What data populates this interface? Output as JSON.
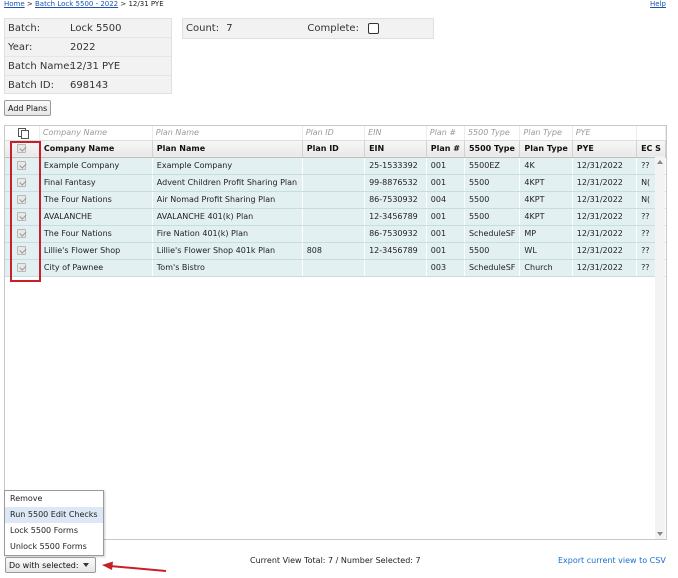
{
  "breadcrumb": {
    "home": "Home",
    "sep1": " > ",
    "batch": "Batch Lock 5500 - 2022",
    "sep2": " > ",
    "current": "12/31 PYE"
  },
  "help": "Help",
  "batch_info": [
    {
      "label": "Batch:",
      "value": "Lock 5500"
    },
    {
      "label": "Year:",
      "value": "2022"
    },
    {
      "label": "Batch Name:",
      "value": "12/31 PYE"
    },
    {
      "label": "Batch ID:",
      "value": "698143"
    }
  ],
  "count": {
    "label": "Count:",
    "value": "7",
    "complete_label": "Complete:",
    "complete_checked": false
  },
  "add_plans_label": "Add Plans",
  "grid": {
    "filter_placeholders": [
      "Company Name",
      "Plan Name",
      "Plan ID",
      "EIN",
      "Plan #",
      "5500 Type",
      "Plan Type",
      "PYE"
    ],
    "columns": [
      "Company Name",
      "Plan Name",
      "Plan ID",
      "EIN",
      "Plan #",
      "5500 Type",
      "Plan Type",
      "PYE",
      "EC S"
    ],
    "rows": [
      {
        "checked": true,
        "company": "Example Company",
        "plan_name": "Example Company",
        "plan_id": "",
        "ein": "25-1533392",
        "plan_num": "001",
        "type_5500": "5500EZ",
        "plan_type": "4K",
        "pye": "12/31/2022",
        "ec": "??"
      },
      {
        "checked": true,
        "company": "Final Fantasy",
        "plan_name": "Advent Children Profit Sharing Plan",
        "plan_id": "",
        "ein": "99-8876532",
        "plan_num": "001",
        "type_5500": "5500",
        "plan_type": "4KPT",
        "pye": "12/31/2022",
        "ec": "N("
      },
      {
        "checked": true,
        "company": "The Four Nations",
        "plan_name": "Air Nomad Profit Sharing Plan",
        "plan_id": "",
        "ein": "86-7530932",
        "plan_num": "004",
        "type_5500": "5500",
        "plan_type": "4KPT",
        "pye": "12/31/2022",
        "ec": "N("
      },
      {
        "checked": true,
        "company": "AVALANCHE",
        "plan_name": "AVALANCHE 401(k) Plan",
        "plan_id": "",
        "ein": "12-3456789",
        "plan_num": "001",
        "type_5500": "5500",
        "plan_type": "4KPT",
        "pye": "12/31/2022",
        "ec": "??"
      },
      {
        "checked": true,
        "company": "The Four Nations",
        "plan_name": "Fire Nation 401(k) Plan",
        "plan_id": "",
        "ein": "86-7530932",
        "plan_num": "001",
        "type_5500": "ScheduleSF",
        "plan_type": "MP",
        "pye": "12/31/2022",
        "ec": "??"
      },
      {
        "checked": true,
        "company": "Lillie's Flower Shop",
        "plan_name": "Lillie's Flower Shop 401k Plan",
        "plan_id": "808",
        "ein": "12-3456789",
        "plan_num": "001",
        "type_5500": "5500",
        "plan_type": "WL",
        "pye": "12/31/2022",
        "ec": "??"
      },
      {
        "checked": true,
        "company": "City of Pawnee",
        "plan_name": "Tom's Bistro",
        "plan_id": "",
        "ein": "",
        "plan_num": "003",
        "type_5500": "ScheduleSF",
        "plan_type": "Church",
        "pye": "12/31/2022",
        "ec": "??"
      }
    ]
  },
  "menu_items": [
    "Remove",
    "Run 5500 Edit Checks",
    "Lock 5500 Forms",
    "Unlock 5500 Forms"
  ],
  "menu_active_index": 1,
  "do_with_label": "Do with selected:",
  "footer_totals": "Current View Total: 7 / Number Selected: 7",
  "export_label": "Export current view to CSV",
  "colors": {
    "link": "#1a56b0",
    "row_bg": "#e2f0f2",
    "highlight": "#c8202a",
    "menu_active": "#dce8f6"
  },
  "icons": [
    "copy-icon",
    "checkbox-icon",
    "scroll-up-icon",
    "scroll-down-icon",
    "dropdown-caret-icon",
    "red-arrow-icon"
  ]
}
